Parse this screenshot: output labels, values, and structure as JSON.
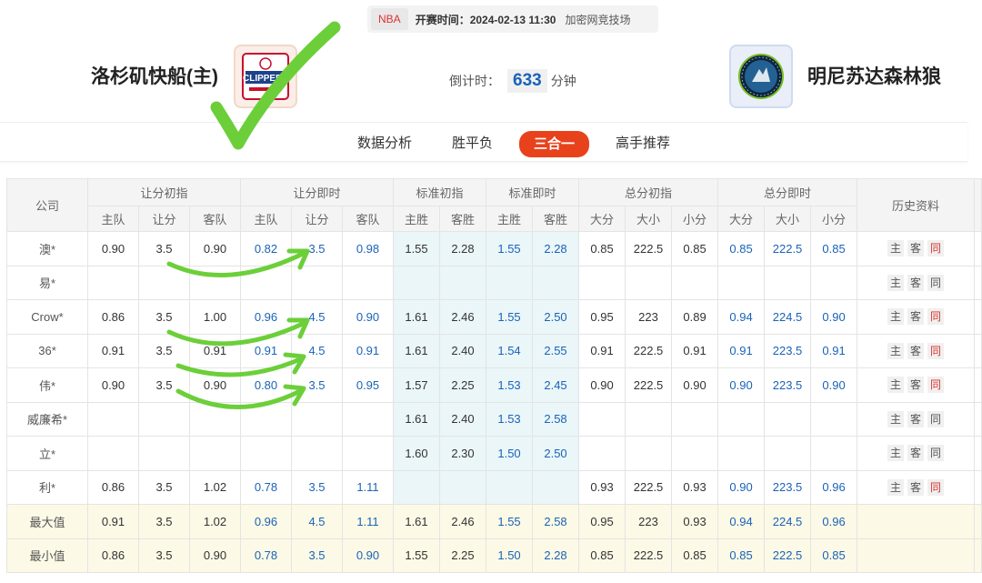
{
  "match": {
    "league": "NBA",
    "time_label": "开赛时间：2024-02-13 11:30",
    "venue": "加密网竞技场",
    "home_team": "洛杉矶快船(主)",
    "away_team": "明尼苏达森林狼",
    "countdown_label": "倒计时：",
    "countdown_value": "633",
    "countdown_unit": "分钟"
  },
  "tabs": [
    {
      "label": "数据分析",
      "active": false
    },
    {
      "label": "胜平负",
      "active": false
    },
    {
      "label": "三合一",
      "active": true
    },
    {
      "label": "高手推荐",
      "active": false
    }
  ],
  "table": {
    "group_headers": [
      "公司",
      "让分初指",
      "让分即时",
      "标准初指",
      "标准即时",
      "总分初指",
      "总分即时",
      "历史资料"
    ],
    "sub_headers": {
      "handicap": [
        "主队",
        "让分",
        "客队"
      ],
      "standard": [
        "主胜",
        "客胜"
      ],
      "total": [
        "大分",
        "大小",
        "小分"
      ]
    },
    "history_buttons": [
      "主",
      "客",
      "同"
    ],
    "rows": [
      {
        "company": "澳*",
        "ho": [
          "0.90",
          "3.5",
          "0.90"
        ],
        "hl": [
          "0.82",
          "3.5",
          "0.98"
        ],
        "so": [
          "1.55",
          "2.28"
        ],
        "sl": [
          "1.55",
          "2.28"
        ],
        "to": [
          "0.85",
          "222.5",
          "0.85"
        ],
        "tl": [
          "0.85",
          "222.5",
          "0.85"
        ],
        "same_active": true
      },
      {
        "company": "易*",
        "ho": [
          "",
          "",
          ""
        ],
        "hl": [
          "",
          "",
          ""
        ],
        "so": [
          "",
          ""
        ],
        "sl": [
          "",
          ""
        ],
        "to": [
          "",
          "",
          ""
        ],
        "tl": [
          "",
          "",
          ""
        ],
        "same_active": false
      },
      {
        "company": "Crow*",
        "ho": [
          "0.86",
          "3.5",
          "1.00"
        ],
        "hl": [
          "0.96",
          "4.5",
          "0.90"
        ],
        "so": [
          "1.61",
          "2.46"
        ],
        "sl": [
          "1.55",
          "2.50"
        ],
        "to": [
          "0.95",
          "223",
          "0.89"
        ],
        "tl": [
          "0.94",
          "224.5",
          "0.90"
        ],
        "same_active": true
      },
      {
        "company": "36*",
        "ho": [
          "0.91",
          "3.5",
          "0.91"
        ],
        "hl": [
          "0.91",
          "4.5",
          "0.91"
        ],
        "so": [
          "1.61",
          "2.40"
        ],
        "sl": [
          "1.54",
          "2.55"
        ],
        "to": [
          "0.91",
          "222.5",
          "0.91"
        ],
        "tl": [
          "0.91",
          "223.5",
          "0.91"
        ],
        "same_active": true
      },
      {
        "company": "伟*",
        "ho": [
          "0.90",
          "3.5",
          "0.90"
        ],
        "hl": [
          "0.80",
          "3.5",
          "0.95"
        ],
        "so": [
          "1.57",
          "2.25"
        ],
        "sl": [
          "1.53",
          "2.45"
        ],
        "to": [
          "0.90",
          "222.5",
          "0.90"
        ],
        "tl": [
          "0.90",
          "223.5",
          "0.90"
        ],
        "same_active": true
      },
      {
        "company": "威廉希*",
        "ho": [
          "",
          "",
          ""
        ],
        "hl": [
          "",
          "",
          ""
        ],
        "so": [
          "1.61",
          "2.40"
        ],
        "sl": [
          "1.53",
          "2.58"
        ],
        "to": [
          "",
          "",
          ""
        ],
        "tl": [
          "",
          "",
          ""
        ],
        "same_active": false
      },
      {
        "company": "立*",
        "ho": [
          "",
          "",
          ""
        ],
        "hl": [
          "",
          "",
          ""
        ],
        "so": [
          "1.60",
          "2.30"
        ],
        "sl": [
          "1.50",
          "2.50"
        ],
        "to": [
          "",
          "",
          ""
        ],
        "tl": [
          "",
          "",
          ""
        ],
        "same_active": false
      },
      {
        "company": "利*",
        "ho": [
          "0.86",
          "3.5",
          "1.02"
        ],
        "hl": [
          "0.78",
          "3.5",
          "1.11"
        ],
        "so": [
          "",
          ""
        ],
        "sl": [
          "",
          ""
        ],
        "to": [
          "0.93",
          "222.5",
          "0.93"
        ],
        "tl": [
          "0.90",
          "223.5",
          "0.96"
        ],
        "same_active": true
      }
    ],
    "summary_rows": [
      {
        "label": "最大值",
        "ho": [
          "0.91",
          "3.5",
          "1.02"
        ],
        "hl": [
          "0.96",
          "4.5",
          "1.11"
        ],
        "so": [
          "1.61",
          "2.46"
        ],
        "sl": [
          "1.55",
          "2.58"
        ],
        "to": [
          "0.95",
          "223",
          "0.93"
        ],
        "tl": [
          "0.94",
          "224.5",
          "0.96"
        ]
      },
      {
        "label": "最小值",
        "ho": [
          "0.86",
          "3.5",
          "0.90"
        ],
        "hl": [
          "0.78",
          "3.5",
          "0.90"
        ],
        "so": [
          "1.55",
          "2.25"
        ],
        "sl": [
          "1.50",
          "2.28"
        ],
        "to": [
          "0.85",
          "222.5",
          "0.85"
        ],
        "tl": [
          "0.85",
          "222.5",
          "0.85"
        ]
      }
    ]
  },
  "colors": {
    "accent": "#e8421c",
    "live_value": "#1a63b8",
    "annotation": "#6ccf3a",
    "same_button_active": "#d9342b"
  },
  "logos": {
    "home": "CLIPPERS",
    "away": "timberwolves-logo"
  }
}
